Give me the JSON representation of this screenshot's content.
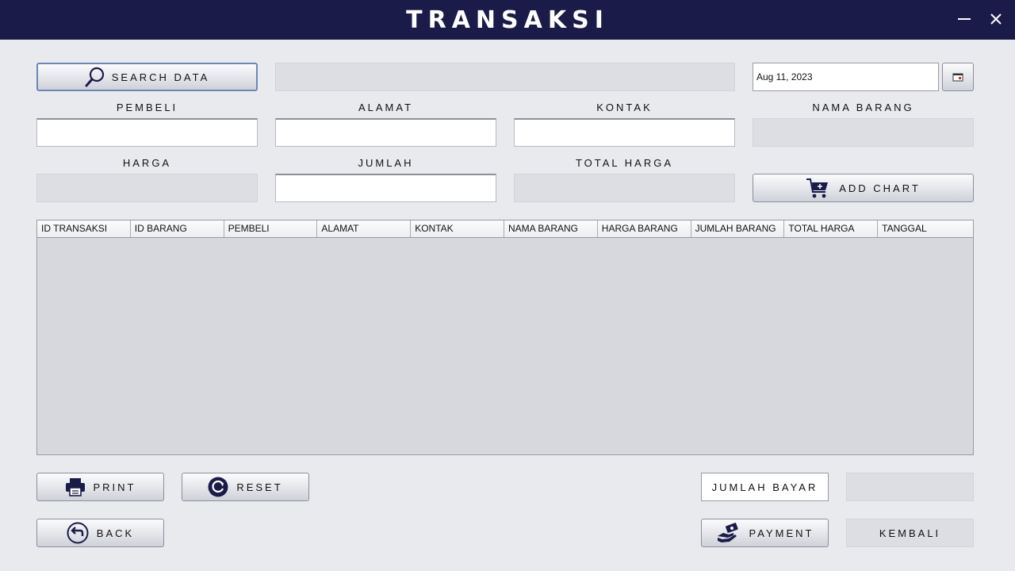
{
  "window": {
    "title": "TRANSAKSI"
  },
  "toolbar": {
    "search_label": "SEARCH DATA",
    "search_value": "",
    "date_value": "Aug 11, 2023"
  },
  "form": {
    "pembeli_label": "PEMBELI",
    "alamat_label": "ALAMAT",
    "kontak_label": "KONTAK",
    "nama_barang_label": "NAMA BARANG",
    "harga_label": "HARGA",
    "jumlah_label": "JUMLAH",
    "total_harga_label": "TOTAL HARGA",
    "pembeli_value": "",
    "alamat_value": "",
    "kontak_value": "",
    "nama_barang_value": "",
    "harga_value": "",
    "jumlah_value": "",
    "total_harga_value": "",
    "add_chart_label": "ADD CHART"
  },
  "table": {
    "columns": [
      "ID TRANSAKSI",
      "ID BARANG",
      "PEMBELI",
      "ALAMAT",
      "KONTAK",
      "NAMA BARANG",
      "HARGA BARANG",
      "JUMLAH BARANG",
      "TOTAL HARGA",
      "TANGGAL"
    ],
    "rows": []
  },
  "actions": {
    "print_label": "PRINT",
    "reset_label": "RESET",
    "back_label": "BACK",
    "jumlah_bayar_label": "JUMLAH BAYAR",
    "jumlah_bayar_value": "",
    "payment_label": "PAYMENT",
    "kembali_label": "KEMBALI"
  },
  "colors": {
    "titlebar": "#1b1b4a",
    "icon": "#1b1b4a",
    "background": "#e9eaee"
  },
  "icons": [
    "minimize-icon",
    "close-icon",
    "search-icon",
    "calendar-icon",
    "cart-icon",
    "printer-icon",
    "reset-icon",
    "back-icon",
    "payment-icon"
  ]
}
